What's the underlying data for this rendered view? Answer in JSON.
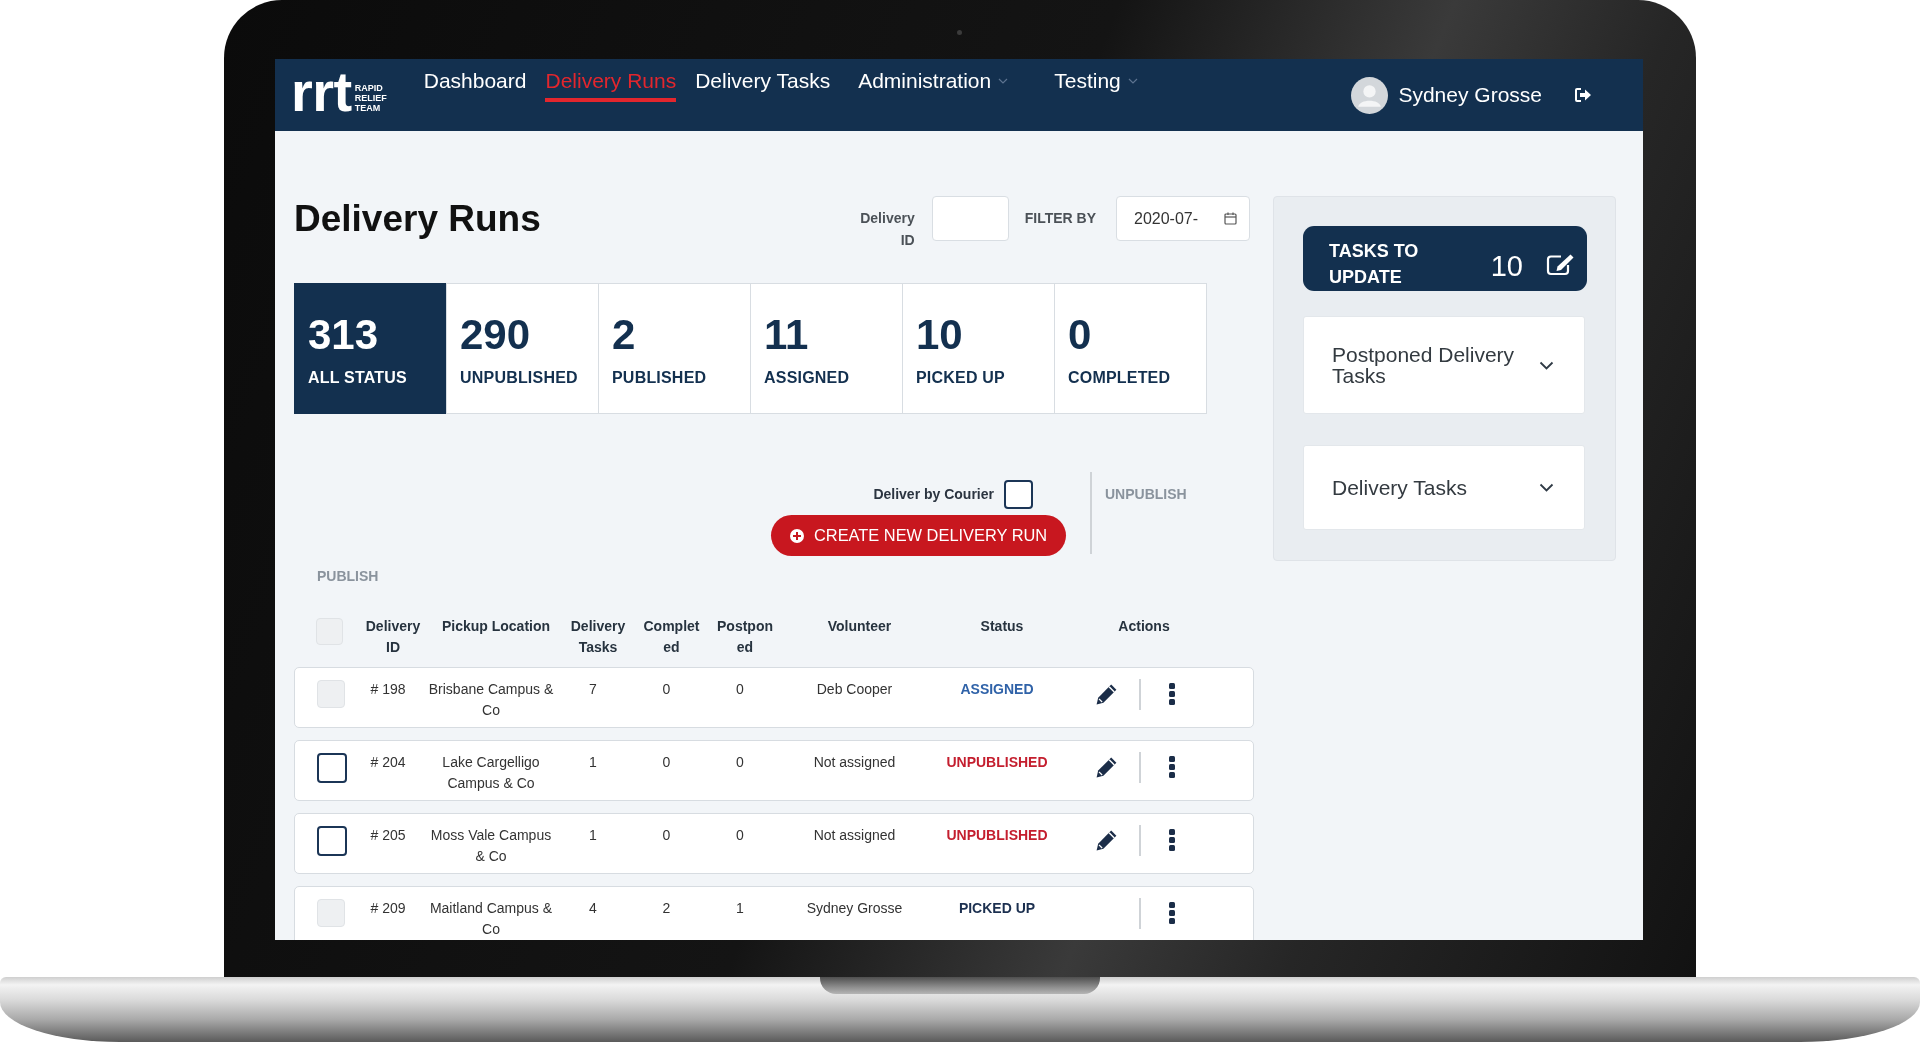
{
  "navbar": {
    "logo": {
      "wordmark": "rrt",
      "tagline": "RAPID RELIEF TEAM"
    },
    "items": [
      {
        "label": "Dashboard",
        "selected": false,
        "dropdown": false
      },
      {
        "label": "Delivery Runs",
        "selected": true,
        "dropdown": false
      },
      {
        "label": "Delivery Tasks",
        "selected": false,
        "dropdown": false
      },
      {
        "label": "Administration",
        "selected": false,
        "dropdown": true
      },
      {
        "label": "Testing",
        "selected": false,
        "dropdown": true
      }
    ],
    "user": {
      "name": "Sydney Grosse"
    }
  },
  "page_title": "Delivery Runs",
  "filters": {
    "delivery_id": {
      "label": "Delivery ID"
    },
    "date": {
      "label": "FILTER BY",
      "value": "2020-07-"
    }
  },
  "status_tabs": [
    {
      "count": "313",
      "label": "ALL STATUS",
      "selected": true
    },
    {
      "count": "290",
      "label": "UNPUBLISHED",
      "selected": false
    },
    {
      "count": "2",
      "label": "PUBLISHED",
      "selected": false
    },
    {
      "count": "11",
      "label": "ASSIGNED",
      "selected": false
    },
    {
      "count": "10",
      "label": "PICKED UP",
      "selected": false
    },
    {
      "count": "0",
      "label": "COMPLETED",
      "selected": false
    }
  ],
  "actions": {
    "courier": {
      "label": "Deliver by Courier",
      "checked": false
    },
    "create_button": {
      "label": "CREATE NEW DELIVERY RUN"
    },
    "unpublish": {
      "label": "UNPUBLISH",
      "disabled": true
    },
    "publish": {
      "label": "PUBLISH",
      "disabled": true
    }
  },
  "table": {
    "select_all": {
      "disabled": true
    },
    "columns": [
      "Delivery ID",
      "Pickup Location",
      "Delivery Tasks",
      "Completed",
      "Postponed",
      "Volunteer",
      "Status",
      "Actions"
    ],
    "rows": [
      {
        "checkbox_disabled": true,
        "id": "# 198",
        "pickup_location": "Brisbane Campus & Co",
        "delivery_tasks": "7",
        "completed": "0",
        "postponed": "0",
        "volunteer": "Deb Cooper",
        "status": "ASSIGNED",
        "color": "#2f62a8",
        "editable": true
      },
      {
        "checkbox_disabled": false,
        "id": "# 204",
        "pickup_location": "Lake Cargelligo Campus & Co",
        "delivery_tasks": "1",
        "completed": "0",
        "postponed": "0",
        "volunteer": "Not assigned",
        "status": "UNPUBLISHED",
        "color": "#c41e2e",
        "editable": true
      },
      {
        "checkbox_disabled": false,
        "id": "# 205",
        "pickup_location": "Moss Vale Campus & Co",
        "delivery_tasks": "1",
        "completed": "0",
        "postponed": "0",
        "volunteer": "Not assigned",
        "status": "UNPUBLISHED",
        "color": "#c41e2e",
        "editable": true
      },
      {
        "checkbox_disabled": true,
        "id": "# 209",
        "pickup_location": "Maitland Campus & Co",
        "delivery_tasks": "4",
        "completed": "2",
        "postponed": "1",
        "volunteer": "Sydney Grosse",
        "status": "PICKED UP",
        "color": "#1c3050",
        "editable": false
      }
    ]
  },
  "side_panel": {
    "tasks_to_update": {
      "label": "TASKS TO UPDATE",
      "count": "10"
    },
    "sections": [
      {
        "title": "Postponed Delivery Tasks",
        "expanded": false
      },
      {
        "title": "Delivery Tasks",
        "expanded": false
      }
    ]
  }
}
